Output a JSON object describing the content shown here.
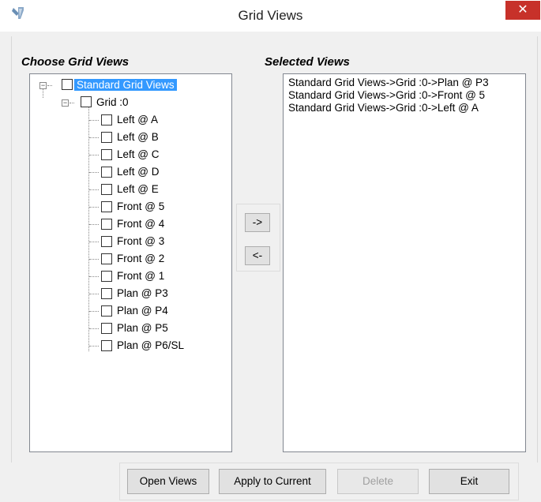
{
  "window": {
    "title": "Grid Views",
    "close_symbol": "✕",
    "icon": "tools-icon"
  },
  "left_group": {
    "label": "Choose Grid Views",
    "tree": {
      "root": "Standard Grid Views",
      "grid": "Grid :0",
      "items": [
        "Left @ A",
        "Left @ B",
        "Left @ C",
        "Left @ D",
        "Left @ E",
        "Front @ 5",
        "Front @ 4",
        "Front @ 3",
        "Front @ 2",
        "Front @ 1",
        "Plan @ P3",
        "Plan @ P4",
        "Plan @ P5",
        "Plan @ P6/SL"
      ]
    }
  },
  "right_group": {
    "label": "Selected Views",
    "items": [
      "Standard Grid Views->Grid :0->Plan @ P3",
      "Standard Grid Views->Grid :0->Front @ 5",
      "Standard Grid Views->Grid :0->Left @ A"
    ]
  },
  "transfer": {
    "add_label": "->",
    "remove_label": "<-"
  },
  "buttons": {
    "open_views": "Open Views",
    "apply_to_current": "Apply to Current",
    "delete": "Delete",
    "exit": "Exit"
  },
  "colors": {
    "close_bg": "#c7312a",
    "selection": "#3399ff"
  }
}
